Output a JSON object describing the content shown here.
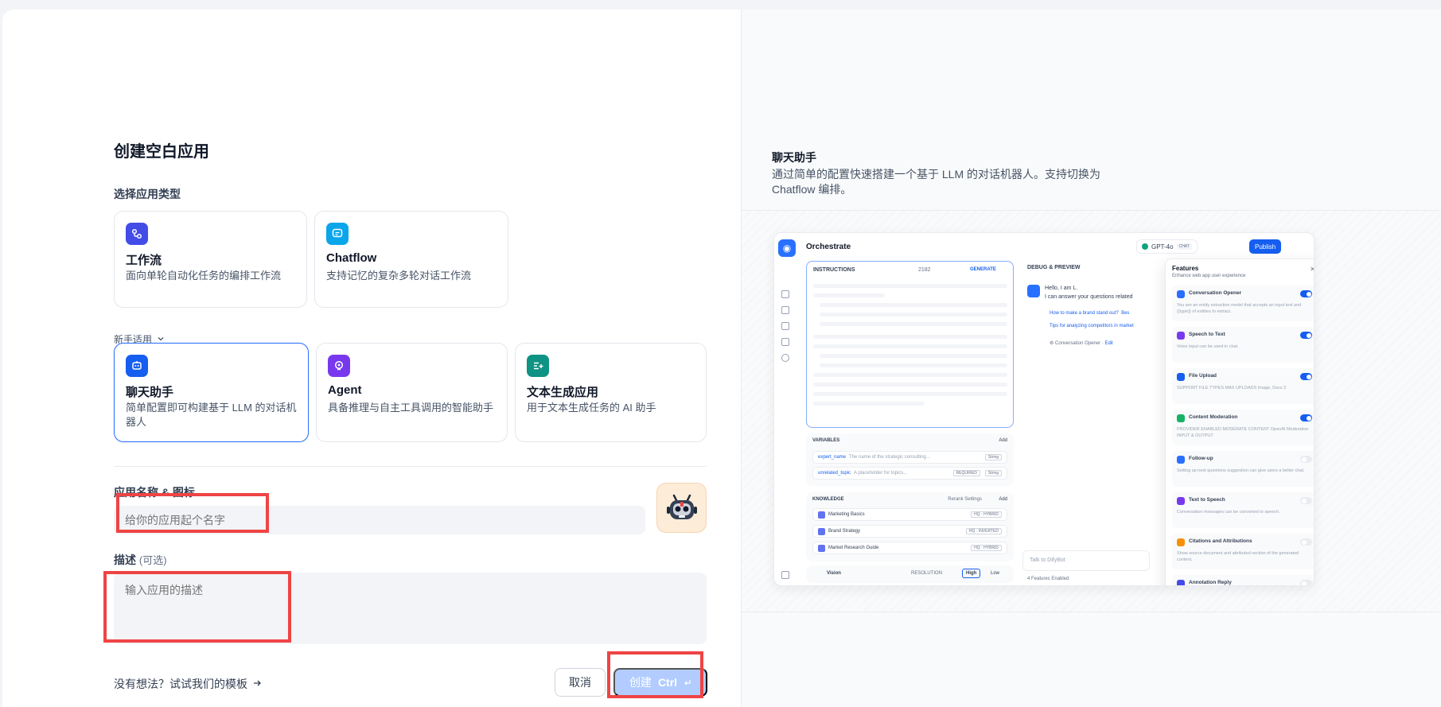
{
  "page": {
    "title": "创建空白应用",
    "select_type_label": "选择应用类型"
  },
  "app_types": [
    {
      "name": "工作流",
      "desc": "面向单轮自动化任务的编排工作流",
      "icon": "workflow-icon",
      "color": "#444ce7"
    },
    {
      "name": "Chatflow",
      "desc": "支持记忆的复杂多轮对话工作流",
      "icon": "chatflow-icon",
      "color": "#0ba5ec"
    }
  ],
  "beginner": {
    "label": "新手适用",
    "cards": [
      {
        "name": "聊天助手",
        "desc": "简单配置即可构建基于 LLM 的对话机器人",
        "icon": "chatbot-icon",
        "color": "#155eef",
        "selected": true
      },
      {
        "name": "Agent",
        "desc": "具备推理与自主工具调用的智能助手",
        "icon": "agent-icon",
        "color": "#7839ee"
      },
      {
        "name": "文本生成应用",
        "desc": "用于文本生成任务的 AI 助手",
        "icon": "text-gen-icon",
        "color": "#0e9384"
      }
    ]
  },
  "form": {
    "name_label": "应用名称 & 图标",
    "name_placeholder": "给你的应用起个名字",
    "desc_label": "描述",
    "desc_optional": "(可选)",
    "desc_placeholder": "输入应用的描述"
  },
  "footer": {
    "template_link": "没有想法？试试我们的模板",
    "cancel": "取消",
    "create": "创建",
    "shortcut": "Ctrl"
  },
  "preview": {
    "title": "聊天助手",
    "desc": "通过简单的配置快速搭建一个基于 LLM 的对话机器人。支持切换为 Chatflow 编排。",
    "mock": {
      "header": "Orchestrate",
      "model": "GPT-4o",
      "model_chip": "CHAT",
      "publish": "Publish",
      "instructions": "INSTRUCTIONS",
      "char_count": "2182",
      "generate": "GENERATE",
      "variables": "VARIABLES",
      "add": "Add",
      "var1_name": "expert_name",
      "var1_desc": "The name of the strategic consulting...",
      "var1_type": "String",
      "var2_name": "unrelated_topic",
      "var2_desc": "A placeholder for topics...",
      "var2_req": "REQUIRED",
      "var2_type": "String",
      "knowledge": "KNOWLEDGE",
      "rerank": "Rerank Settings",
      "kb": [
        {
          "name": "Marketing Basics",
          "tag": "HQ · HYBRID"
        },
        {
          "name": "Brand Strategy",
          "tag": "HQ · INVERTED"
        },
        {
          "name": "Market Research Guide",
          "tag": "HQ · HYBRID"
        }
      ],
      "vision": "Vision",
      "resolution": "RESOLUTION",
      "high": "High",
      "low": "Low",
      "debug": "DEBUG & PREVIEW",
      "hello": "Hello, I am L.",
      "hello2": "I can answer your questions related",
      "sugg1": "How to make a brand stand out?",
      "sugg1b": "Bes",
      "sugg2": "Tips for analyzing competitors in market",
      "opener": "Conversation Opener",
      "edit": "Edit",
      "talk": "Talk to DifyBot",
      "features_enabled": "4 Features Enabled",
      "features_title": "Features",
      "features_sub": "Enhance web app user experience",
      "features": [
        {
          "name": "Conversation Opener",
          "desc": "You are an entity extraction model that accepts an input text and {{type}} of entities to extract.",
          "on": true,
          "color": "#2970ff"
        },
        {
          "name": "Speech to Text",
          "desc": "Voice input can be used in chat.",
          "on": true,
          "color": "#7839ee"
        },
        {
          "name": "File Upload",
          "desc": "SUPPORT FILE TYPES  MAX UPLOADS  Image, Docs  3",
          "on": true,
          "color": "#155eef"
        },
        {
          "name": "Content Moderation",
          "desc": "PROVIDER  ENABLED MODERATE CONTENT  OpenAI Moderation  INPUT & OUTPUT",
          "on": true,
          "color": "#16b364"
        },
        {
          "name": "Follow-up",
          "desc": "Setting up next questions suggestion can give users a better chat.",
          "on": false,
          "color": "#2970ff"
        },
        {
          "name": "Text to Speech",
          "desc": "Conversation messages can be converted to speech.",
          "on": false,
          "color": "#7839ee"
        },
        {
          "name": "Citations and Attributions",
          "desc": "Show source document and attributed section of the generated content.",
          "on": false,
          "color": "#f79009"
        },
        {
          "name": "Annotation Reply",
          "desc": "",
          "on": false,
          "color": "#444ce7"
        }
      ]
    }
  }
}
